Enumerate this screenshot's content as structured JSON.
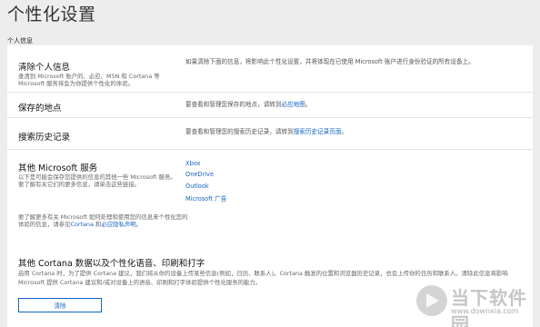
{
  "page_title": "个性化设置",
  "section_label": "个人信息",
  "rows": {
    "clear": {
      "title": "清除个人信息",
      "desc": "查清到 Microsoft 账户的、必应、MSN 和 Cortana 等 Microsoft 服务将会为你提供个性化的体验。",
      "right": "如果清除下面的信息，将影响此个性化设置，并将体现在已使用 Microsoft 账户进行身份验证的所有设备上。"
    },
    "places": {
      "title": "保存的地点",
      "right_prefix": "要查看和管理您保存的地点，请转到",
      "right_link": "必应地图",
      "right_suffix": "。"
    },
    "search": {
      "title": "搜索历史记录",
      "right_prefix": "要查看和管理您的搜索历史记录，请转到",
      "right_link": "搜索历史记录页面",
      "right_suffix": "。"
    },
    "other": {
      "title": "其他 Microsoft 服务",
      "desc": "以下是可能会保存您提供的信息的其他一些 Microsoft 服务。要了解有关它们的更多信息，请单击这些链接。",
      "links": [
        "Xbox",
        "OneDrive",
        "Outlook",
        "Microsoft 广告"
      ]
    }
  },
  "note": {
    "text": "要了解更多有关 Microsoft 如何处理和使用您的信息来个性化您的体验的信息，请参见",
    "link_cortana": "Cortana",
    "joiner": " 和",
    "link_privacy": "必应隐私声明",
    "suffix": "。"
  },
  "cortana": {
    "title": "其他 Cortana 数据以及个性化语音、印刷和打字",
    "desc": "启用 Cortana 时，为了提供 Cortana 建议，我们将从你的设备上传某些信息(例如，日历、联系人)。Cortana 触发的位置和浏览器历史记录，也会上传你的日历和联系人。清除此信息将影响 Microsoft 提供 Cortana 建议和/或对设备上的语音、印刷和打字体验提供个性化服务的能力。",
    "button": "清除"
  },
  "watermark": {
    "cn": "当下软件园",
    "url": "www.downxia.com"
  },
  "colors": {
    "link": "#1565c0",
    "background": "#ededed",
    "card": "#ffffff"
  }
}
